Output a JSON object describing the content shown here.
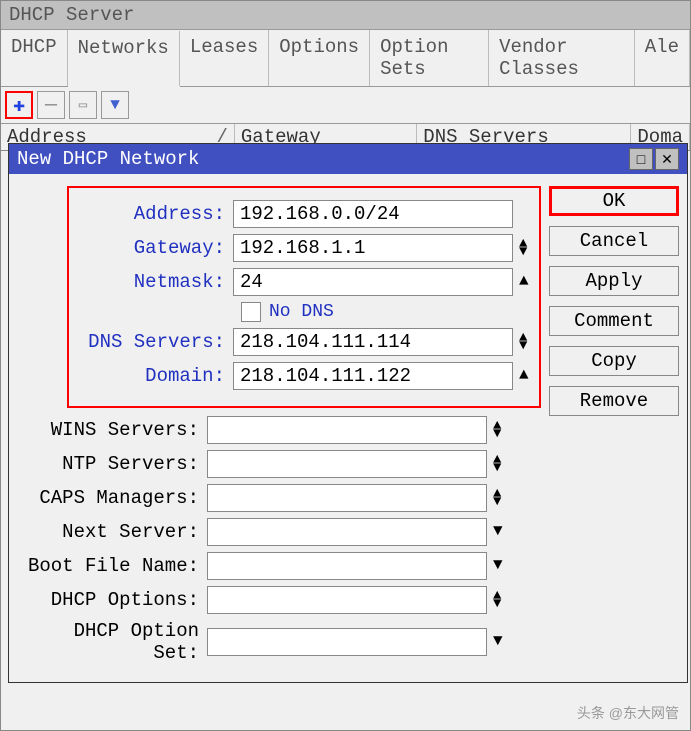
{
  "window": {
    "title": "DHCP Server"
  },
  "tabs": [
    "DHCP",
    "Networks",
    "Leases",
    "Options",
    "Option Sets",
    "Vendor Classes",
    "Ale"
  ],
  "active_tab": 1,
  "columns": {
    "address": "Address",
    "gateway": "Gateway",
    "dns": "DNS Servers",
    "domain": "Doma"
  },
  "dialog": {
    "title": "New DHCP Network",
    "labels": {
      "address": "Address:",
      "gateway": "Gateway:",
      "netmask": "Netmask:",
      "nodns": "No DNS",
      "dns": "DNS Servers:",
      "domain": "Domain:",
      "wins": "WINS Servers:",
      "ntp": "NTP Servers:",
      "caps": "CAPS Managers:",
      "next": "Next Server:",
      "boot": "Boot File Name:",
      "dhcpopt": "DHCP Options:",
      "dhcpset": "DHCP Option Set:"
    },
    "values": {
      "address": "192.168.0.0/24",
      "gateway": "192.168.1.1",
      "netmask": "24",
      "dns": "218.104.111.114",
      "domain": "218.104.111.122",
      "wins": "",
      "ntp": "",
      "caps": "",
      "next": "",
      "boot": "",
      "dhcpopt": "",
      "dhcpset": ""
    },
    "buttons": {
      "ok": "OK",
      "cancel": "Cancel",
      "apply": "Apply",
      "comment": "Comment",
      "copy": "Copy",
      "remove": "Remove"
    }
  },
  "watermark": "头条 @东大网管"
}
